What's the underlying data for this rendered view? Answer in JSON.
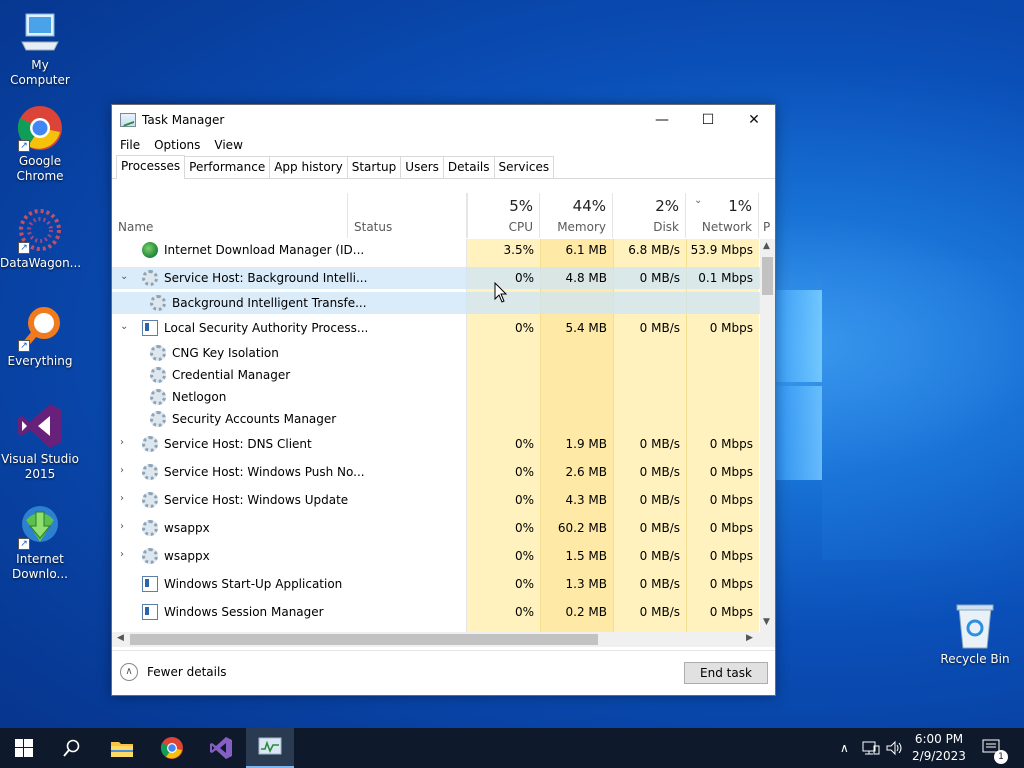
{
  "desktop": {
    "icons": [
      {
        "label": "My Computer",
        "icon": "computer-icon"
      },
      {
        "label": "Google Chrome",
        "icon": "chrome-icon"
      },
      {
        "label": "DataWagon...",
        "icon": "datawagon-icon"
      },
      {
        "label": "Everything",
        "icon": "everything-icon"
      },
      {
        "label": "Visual Studio 2015",
        "icon": "visual-studio-icon"
      },
      {
        "label": "Internet Downlo...",
        "icon": "idm-icon"
      },
      {
        "label": "Recycle Bin",
        "icon": "recycle-bin-icon"
      }
    ]
  },
  "window": {
    "title": "Task Manager",
    "minimize": "—",
    "maximize": "☐",
    "close": "✕"
  },
  "menu": {
    "file": "File",
    "options": "Options",
    "view": "View"
  },
  "tabs": [
    "Processes",
    "Performance",
    "App history",
    "Startup",
    "Users",
    "Details",
    "Services"
  ],
  "columns": {
    "name": "Name",
    "status": "Status",
    "cpu": {
      "pct": "5%",
      "label": "CPU"
    },
    "memory": {
      "pct": "44%",
      "label": "Memory"
    },
    "disk": {
      "pct": "2%",
      "label": "Disk"
    },
    "network": {
      "pct": "1%",
      "label": "Network"
    },
    "power": "P"
  },
  "rows": [
    {
      "name": "Internet Download Manager (ID...",
      "cpu": "3.5%",
      "mem": "6.1 MB",
      "disk": "6.8 MB/s",
      "net": "53.9 Mbps"
    },
    {
      "name": "Service Host: Background Intelli...",
      "cpu": "0%",
      "mem": "4.8 MB",
      "disk": "0 MB/s",
      "net": "0.1 Mbps"
    },
    {
      "name": "Background Intelligent Transfe..."
    },
    {
      "name": "Local Security Authority Process...",
      "cpu": "0%",
      "mem": "5.4 MB",
      "disk": "0 MB/s",
      "net": "0 Mbps"
    },
    {
      "name": "CNG Key Isolation"
    },
    {
      "name": "Credential Manager"
    },
    {
      "name": "Netlogon"
    },
    {
      "name": "Security Accounts Manager"
    },
    {
      "name": "Service Host: DNS Client",
      "cpu": "0%",
      "mem": "1.9 MB",
      "disk": "0 MB/s",
      "net": "0 Mbps"
    },
    {
      "name": "Service Host: Windows Push No...",
      "cpu": "0%",
      "mem": "2.6 MB",
      "disk": "0 MB/s",
      "net": "0 Mbps"
    },
    {
      "name": "Service Host: Windows Update",
      "cpu": "0%",
      "mem": "4.3 MB",
      "disk": "0 MB/s",
      "net": "0 Mbps"
    },
    {
      "name": "wsappx",
      "cpu": "0%",
      "mem": "60.2 MB",
      "disk": "0 MB/s",
      "net": "0 Mbps"
    },
    {
      "name": "wsappx",
      "cpu": "0%",
      "mem": "1.5 MB",
      "disk": "0 MB/s",
      "net": "0 Mbps"
    },
    {
      "name": "Windows Start-Up Application",
      "cpu": "0%",
      "mem": "1.3 MB",
      "disk": "0 MB/s",
      "net": "0 Mbps"
    },
    {
      "name": "Windows Session Manager",
      "cpu": "0%",
      "mem": "0.2 MB",
      "disk": "0 MB/s",
      "net": "0 Mbps"
    }
  ],
  "footer": {
    "fewer_details": "Fewer details",
    "end_task": "End task"
  },
  "taskbar": {
    "time": "6:00 PM",
    "date": "2/9/2023",
    "notifications": "1"
  },
  "colors": {
    "heat_light": "#fff4c4",
    "heat_mid": "#ffe9a0",
    "selected": "#cde4f7",
    "accent": "#0078d7"
  }
}
